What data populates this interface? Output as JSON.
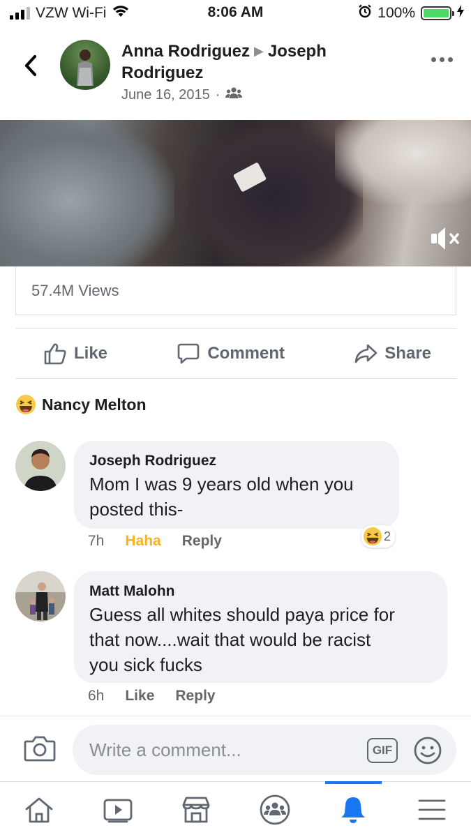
{
  "status_bar": {
    "carrier": "VZW Wi-Fi",
    "time": "8:06 AM",
    "battery_percent": "100%",
    "battery_level": 1.0,
    "icons": [
      "signal-icon",
      "wifi-icon",
      "alarm-icon",
      "battery-icon",
      "charging-icon"
    ]
  },
  "post": {
    "author": "Anna Rodriguez",
    "target": "Joseph Rodriguez",
    "date": "June 16, 2015",
    "separator": "·",
    "privacy_icon": "friends-icon",
    "views": "57.4M Views"
  },
  "actions": {
    "like": "Like",
    "comment": "Comment",
    "share": "Share"
  },
  "reactions": {
    "reactor_name": "Nancy Melton",
    "reaction_icon": "haha-emoji-icon"
  },
  "comments": [
    {
      "author": "Joseph Rodriguez",
      "text_line1": "Mom I was 9 years old when you",
      "text_line2": "posted this-",
      "time": "7h",
      "reaction_label": "Haha",
      "reply_label": "Reply",
      "reaction_count": "2"
    },
    {
      "author": "Matt Malohn",
      "text_line1": "Guess all whites should paya price for",
      "text_line2": "that now....wait that would be racist",
      "text_line3": "you sick fucks",
      "time": "6h",
      "like_label": "Like",
      "reply_label": "Reply"
    }
  ],
  "composer": {
    "placeholder": "Write a comment...",
    "gif_label": "GIF"
  },
  "tab_bar": {
    "tabs": [
      "home-icon",
      "watch-icon",
      "marketplace-icon",
      "groups-icon",
      "notifications-icon",
      "menu-icon"
    ],
    "active_tab": "notifications-icon"
  },
  "colors": {
    "facebook_blue": "#1877f2",
    "haha_yellow": "#f7b125",
    "bubble_gray": "#f0f2f5",
    "text_gray": "#65676b",
    "battery_green": "#4cd964"
  }
}
